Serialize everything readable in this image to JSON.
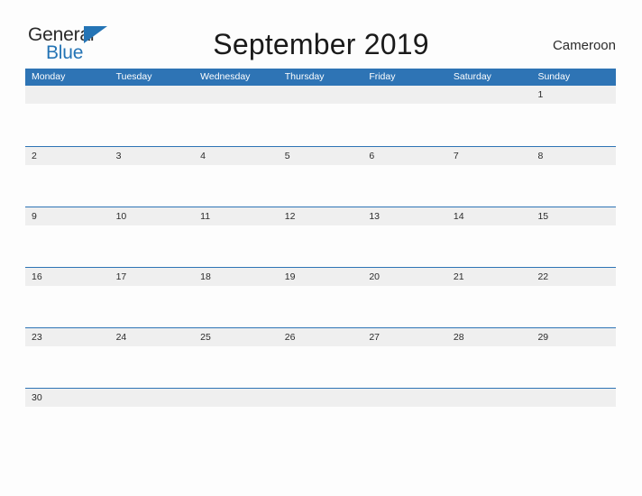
{
  "brand": {
    "name_part1": "General",
    "name_part2": "Blue",
    "triangle_icon": "triangle-icon",
    "accent_color": "#2474b5"
  },
  "header": {
    "title": "September 2019",
    "country": "Cameroon"
  },
  "theme": {
    "header_blue": "#2e74b5",
    "row_gray": "#efefef",
    "page_background": "#fdfdfd",
    "text_dark": "#2b2b2b",
    "text_white": "#ffffff"
  },
  "calendar": {
    "weekday_headers": [
      "Monday",
      "Tuesday",
      "Wednesday",
      "Thursday",
      "Friday",
      "Saturday",
      "Sunday"
    ],
    "weeks": [
      {
        "days": [
          "",
          "",
          "",
          "",
          "",
          "",
          "1"
        ]
      },
      {
        "days": [
          "2",
          "3",
          "4",
          "5",
          "6",
          "7",
          "8"
        ]
      },
      {
        "days": [
          "9",
          "10",
          "11",
          "12",
          "13",
          "14",
          "15"
        ]
      },
      {
        "days": [
          "16",
          "17",
          "18",
          "19",
          "20",
          "21",
          "22"
        ]
      },
      {
        "days": [
          "23",
          "24",
          "25",
          "26",
          "27",
          "28",
          "29"
        ]
      },
      {
        "days": [
          "30",
          "",
          "",
          "",
          "",
          "",
          ""
        ]
      }
    ]
  }
}
